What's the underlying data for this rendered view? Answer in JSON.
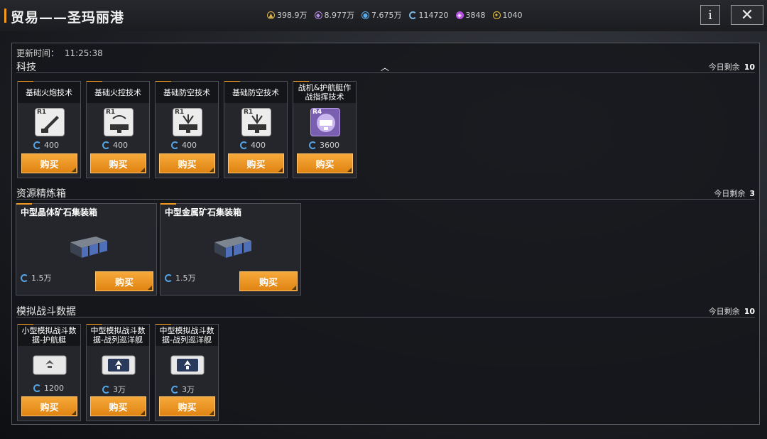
{
  "header": {
    "title": "贸易——圣玛丽港"
  },
  "resources": [
    {
      "icon": "gold-coin-icon",
      "value": "398.9万",
      "color": "#e0b24a"
    },
    {
      "icon": "crystal-icon",
      "value": "8.977万",
      "color": "#b58ce6"
    },
    {
      "icon": "deuterium-icon",
      "value": "7.675万",
      "color": "#5aa8e6"
    },
    {
      "icon": "refresh-currency-icon",
      "value": "114720",
      "color": "#7fb8e0"
    },
    {
      "icon": "purple-gem-icon",
      "value": "3848",
      "color": "#b44fe0"
    },
    {
      "icon": "medal-icon",
      "value": "1040",
      "color": "#e8c13a"
    }
  ],
  "panel": {
    "update_label": "更新时间：",
    "update_time": "11:25:38"
  },
  "sections": {
    "tech": {
      "title": "科技",
      "remain_label": "今日剩余",
      "remain_count": "10",
      "items": [
        {
          "name": "基础火炮技术",
          "rank": "R1",
          "icon": "artillery-tech-icon",
          "price": "400",
          "buy": "购买"
        },
        {
          "name": "基础火控技术",
          "rank": "R1",
          "icon": "fire-control-tech-icon",
          "price": "400",
          "buy": "购买"
        },
        {
          "name": "基础防空技术",
          "rank": "R1",
          "icon": "anti-air-tech-icon",
          "price": "400",
          "buy": "购买"
        },
        {
          "name": "基础防空技术",
          "rank": "R1",
          "icon": "anti-air-tech-icon",
          "price": "400",
          "buy": "购买"
        },
        {
          "name": "战机&护航艇作战指挥技术",
          "rank": "R4",
          "icon": "fighter-command-tech-icon",
          "price": "3600",
          "buy": "购买"
        }
      ]
    },
    "boxes": {
      "title": "资源精炼箱",
      "remain_label": "今日剩余",
      "remain_count": "3",
      "items": [
        {
          "name": "中型晶体矿石集装箱",
          "icon": "container-box-icon",
          "price": "1.5万",
          "buy": "购买"
        },
        {
          "name": "中型金属矿石集装箱",
          "icon": "container-box-icon",
          "price": "1.5万",
          "buy": "购买"
        }
      ]
    },
    "sim": {
      "title": "模拟战斗数据",
      "remain_label": "今日剩余",
      "remain_count": "10",
      "items": [
        {
          "name": "小型模拟战斗数据-护航艇",
          "icon": "sim-data-card-icon",
          "price": "1200",
          "buy": "购买"
        },
        {
          "name": "中型模拟战斗数据-战列巡洋舰",
          "icon": "sim-data-card-icon",
          "price": "3万",
          "buy": "购买"
        },
        {
          "name": "中型模拟战斗数据-战列巡洋舰",
          "icon": "sim-data-card-icon",
          "price": "3万",
          "buy": "购买"
        }
      ]
    }
  }
}
